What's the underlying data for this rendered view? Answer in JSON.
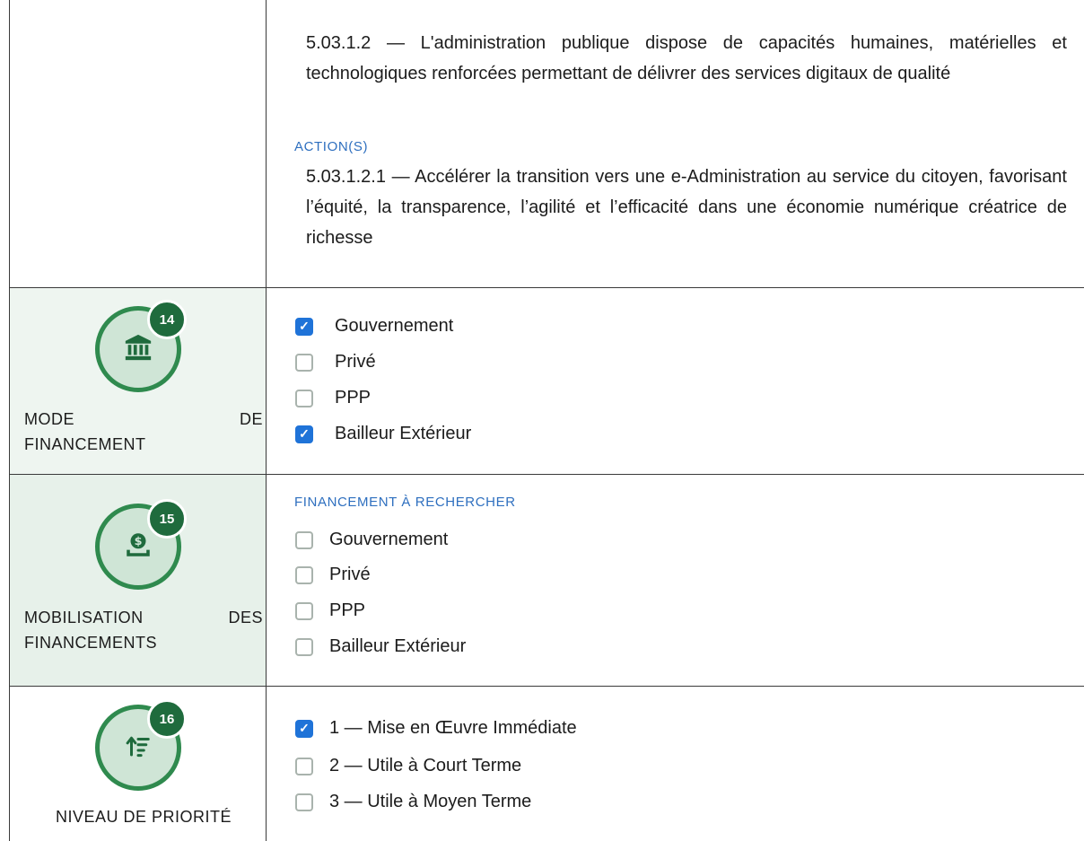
{
  "objective": {
    "text": "5.03.1.2 — L'administration publique dispose de capacités humaines, matérielles et technologiques renforcées permettant de délivrer des services digitaux de qualité"
  },
  "actions": {
    "heading": "ACTION(S)",
    "text": "5.03.1.2.1 — Accélérer la transition vers une e-Administration au service du citoyen, favorisant l’équité, la transparence, l’agilité et l’efficacité dans une économie numérique créatrice de richesse"
  },
  "sections": [
    {
      "number": "14",
      "icon": "bank-icon",
      "label_line1_left": "MODE",
      "label_line1_right": "DE",
      "label_line2": "FINANCEMENT",
      "options": [
        {
          "label": "Gouvernement",
          "checked": true
        },
        {
          "label": "Privé",
          "checked": false
        },
        {
          "label": "PPP",
          "checked": false
        },
        {
          "label": "Bailleur Extérieur",
          "checked": true
        }
      ]
    },
    {
      "number": "15",
      "icon": "money-hand-icon",
      "label_line1_left": "MOBILISATION",
      "label_line1_right": "DES",
      "label_line2": "FINANCEMENTS",
      "subheading": "FINANCEMENT À RECHERCHER",
      "options": [
        {
          "label": "Gouvernement",
          "checked": false
        },
        {
          "label": "Privé",
          "checked": false
        },
        {
          "label": "PPP",
          "checked": false
        },
        {
          "label": "Bailleur Extérieur",
          "checked": false
        }
      ]
    },
    {
      "number": "16",
      "icon": "sort-priority-icon",
      "label": "NIVEAU DE PRIORITÉ",
      "options": [
        {
          "label": "1 — Mise en Œuvre Immédiate",
          "checked": true
        },
        {
          "label": "2 — Utile à Court Terme",
          "checked": false
        },
        {
          "label": "3 — Utile à Moyen Terme",
          "checked": false
        }
      ]
    }
  ],
  "colors": {
    "accent_green": "#2f8a4e",
    "badge_green": "#1f6b3d",
    "checkbox_blue": "#1f73d8",
    "heading_blue": "#2e6fbf"
  }
}
